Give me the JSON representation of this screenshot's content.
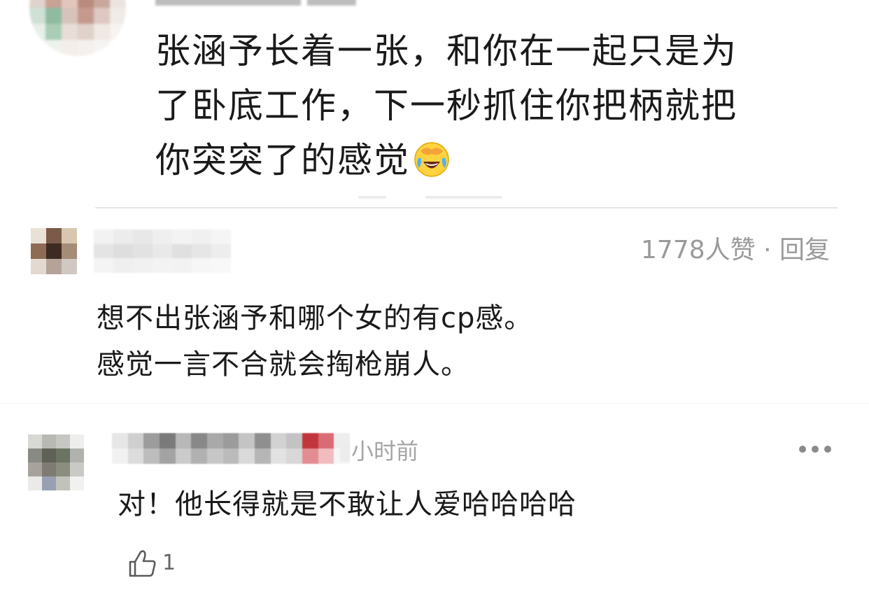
{
  "quoted_comment": {
    "body_lines": [
      "张涵予长着一张，和你在一起只是为",
      "了卧底工作，下一秒抓住你把柄就把",
      "你突突了的感觉"
    ],
    "emoji": "laughing-crying-emoji"
  },
  "main_comment": {
    "likes": "1778人赞",
    "separator": " · ",
    "reply_label": "回复",
    "body_lines": [
      "想不出张涵予和哪个女的有cp感。",
      "感觉一言不合就会掏枪崩人。"
    ]
  },
  "reply": {
    "time": "小时前",
    "body": "对！他长得就是不敢让人爱哈哈哈哈",
    "like_count": "1",
    "icons": {
      "more": "more-dots-icon",
      "like": "thumbs-up-icon"
    }
  },
  "colors": {
    "text": "#1a1a1a",
    "meta": "#9a9a9a",
    "divider": "#e6e6e6",
    "background": "#ffffff"
  }
}
